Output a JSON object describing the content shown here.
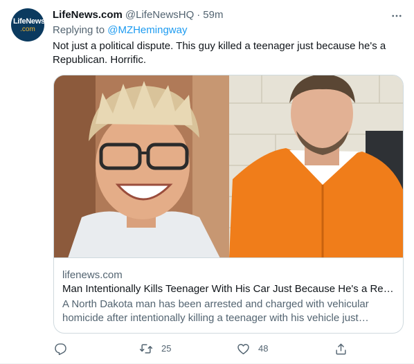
{
  "tweet": {
    "avatar_line1": "LifeNews",
    "avatar_line2": ".com",
    "display_name": "LifeNews.com",
    "handle": "@LifeNewsHQ",
    "separator": "·",
    "time": "59m",
    "replying_label": "Replying to",
    "replying_to": "@MZHemingway",
    "text": "Not just a political dispute. This guy killed a teenager just because he's a Republican. Horrific."
  },
  "card": {
    "domain": "lifenews.com",
    "title": "Man Intentionally Kills Teenager With His Car Just Because He's a Republican",
    "description": "A North Dakota man has been arrested and charged with vehicular homicide after intentionally killing a teenager with his vehicle just because he was a Republican."
  },
  "actions": {
    "reply_count": "",
    "retweet_count": "25",
    "like_count": "48"
  },
  "icons": {
    "reply": "reply-icon",
    "retweet": "retweet-icon",
    "like": "heart-icon",
    "share": "share-icon",
    "more": "more-options-icon"
  },
  "colors": {
    "accent": "#1d9bf0",
    "secondary_text": "#536471",
    "primary_text": "#0f1419",
    "border": "#cfd9de",
    "avatar_bg": "#0b3a5f",
    "avatar_logo_accent": "#f2b632",
    "prison_orange": "#f07d1a"
  }
}
